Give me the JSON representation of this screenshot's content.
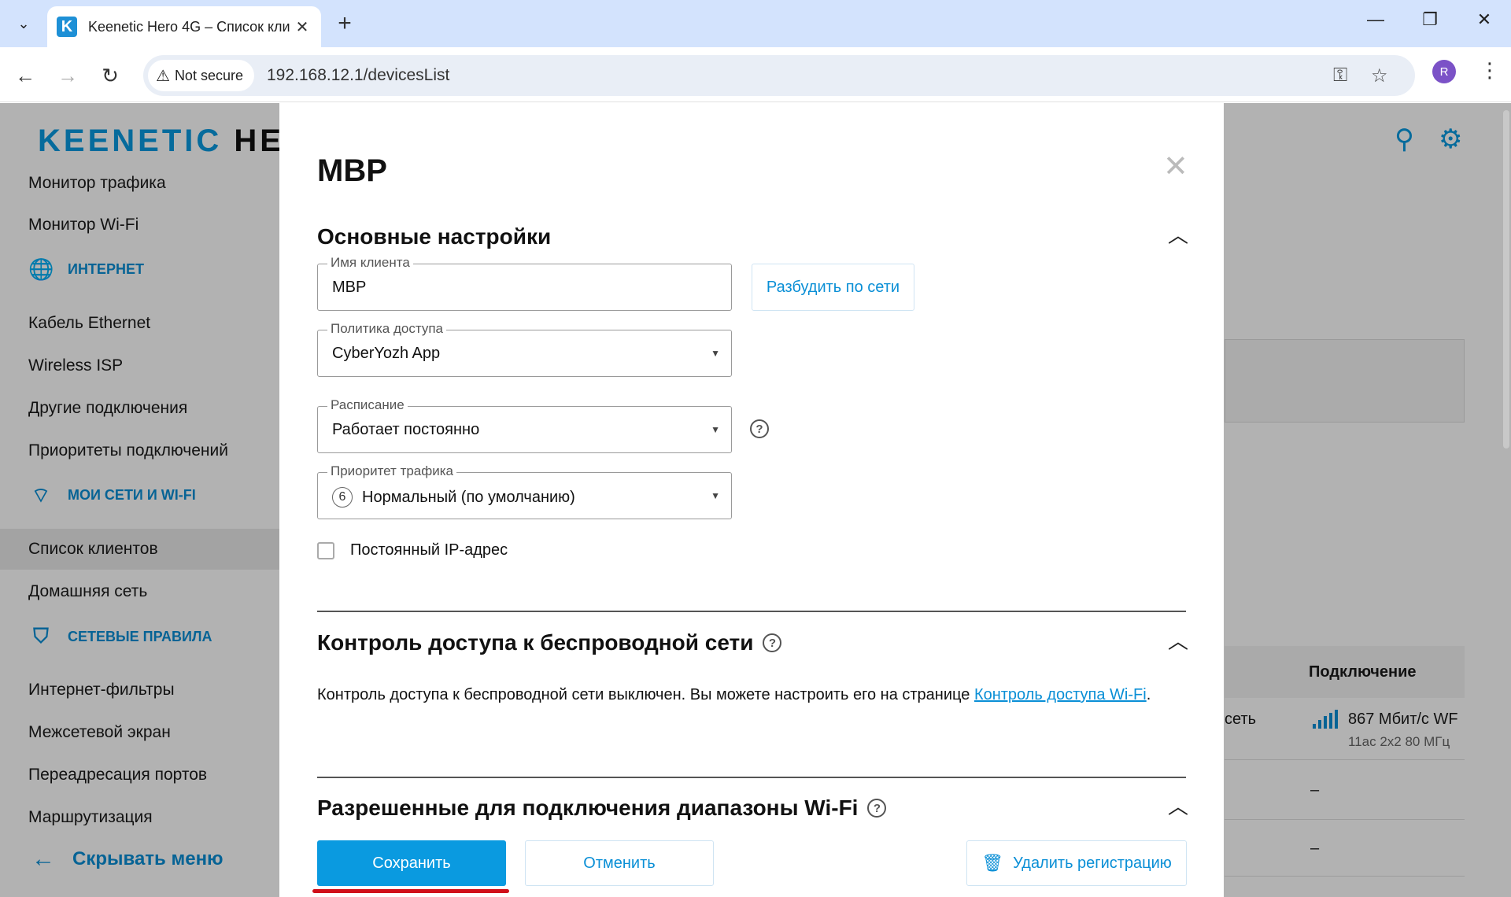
{
  "browser": {
    "tab_title": "Keenetic Hero 4G – Список кли",
    "favicon_letter": "K",
    "security_label": "Not secure",
    "url": "192.168.12.1/devicesList",
    "profile_initial": "R"
  },
  "header": {
    "logo_main": "KEENETIC",
    "logo_tail": "HE"
  },
  "sidebar": {
    "item_traffic": "Монитор трафика",
    "item_wifi_monitor": "Монитор Wi-Fi",
    "section_internet": "ИНТЕРНЕТ",
    "item_ethernet": "Кабель Ethernet",
    "item_wisp": "Wireless ISP",
    "item_other": "Другие подключения",
    "item_priorities": "Приоритеты подключений",
    "section_networks": "МОИ СЕТИ И WI-FI",
    "item_clients": "Список клиентов",
    "item_home": "Домашняя сеть",
    "section_rules": "СЕТЕВЫЕ ПРАВИЛА",
    "item_filters": "Интернет-фильтры",
    "item_firewall": "Межсетевой экран",
    "item_ports": "Переадресация портов",
    "item_routing": "Маршрутизация",
    "hide_menu": "Скрывать меню"
  },
  "background_table": {
    "header_connection": "Подключение",
    "row1_fragment": "сеть",
    "row1_speed": "867 Мбит/с  WF",
    "row1_details": "11ac 2x2 80 МГц",
    "dash": "–"
  },
  "modal": {
    "title": "MBP",
    "section_basic": "Основные настройки",
    "client_name_label": "Имя клиента",
    "client_name_value": "MBP",
    "wake_button": "Разбудить по сети",
    "access_policy_label": "Политика доступа",
    "access_policy_value": "CyberYozh App",
    "schedule_label": "Расписание",
    "schedule_value": "Работает постоянно",
    "priority_label": "Приоритет трафика",
    "priority_badge": "6",
    "priority_value": "Нормальный (по умолчанию)",
    "static_ip_label": "Постоянный IP-адрес",
    "section_wireless": "Контроль доступа к беспроводной сети",
    "wireless_text": "Контроль доступа к беспроводной сети выключен. Вы можете настроить его на странице ",
    "wireless_link": "Контроль доступа Wi-Fi",
    "wireless_text_end": ".",
    "section_ranges": "Разрешенные для подключения диапазоны Wi-Fi",
    "save": "Сохранить",
    "cancel": "Отменить",
    "delete": "Удалить регистрацию"
  },
  "colors": {
    "accent": "#0a9ae0",
    "highlight_underline": "#d0101a"
  }
}
